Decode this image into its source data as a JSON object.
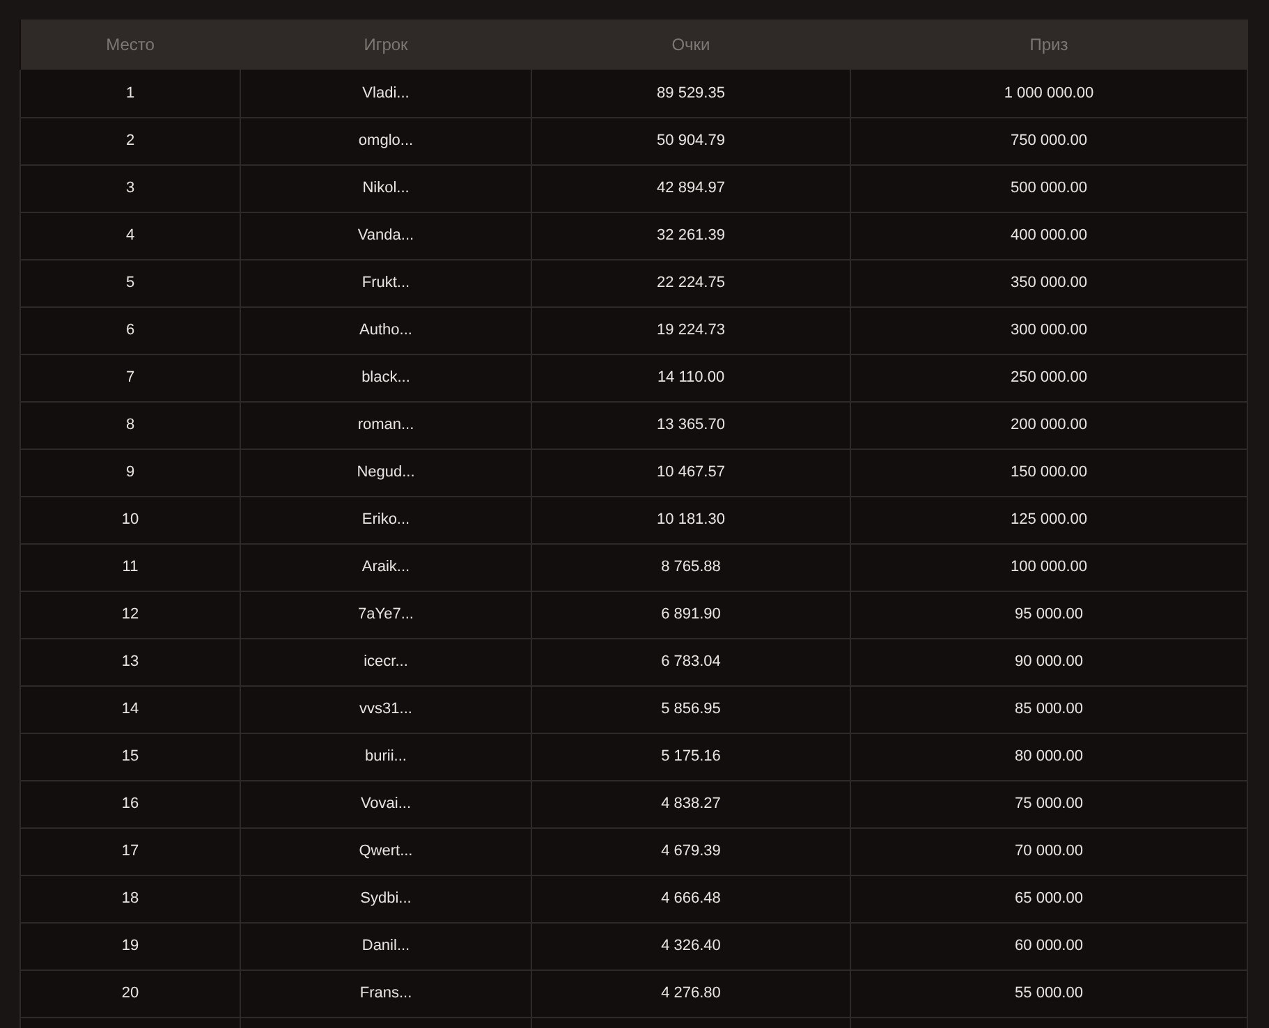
{
  "table": {
    "columns": [
      "Место",
      "Игрок",
      "Очки",
      "Приз"
    ],
    "rows": [
      [
        "1",
        "Vladi...",
        "89 529.35",
        "1 000 000.00"
      ],
      [
        "2",
        "omglo...",
        "50 904.79",
        "750 000.00"
      ],
      [
        "3",
        "Nikol...",
        "42 894.97",
        "500 000.00"
      ],
      [
        "4",
        "Vanda...",
        "32 261.39",
        "400 000.00"
      ],
      [
        "5",
        "Frukt...",
        "22 224.75",
        "350 000.00"
      ],
      [
        "6",
        "Autho...",
        "19 224.73",
        "300 000.00"
      ],
      [
        "7",
        "black...",
        "14 110.00",
        "250 000.00"
      ],
      [
        "8",
        "roman...",
        "13 365.70",
        "200 000.00"
      ],
      [
        "9",
        "Negud...",
        "10 467.57",
        "150 000.00"
      ],
      [
        "10",
        "Eriko...",
        "10 181.30",
        "125 000.00"
      ],
      [
        "11",
        "Araik...",
        "8 765.88",
        "100 000.00"
      ],
      [
        "12",
        "7aYe7...",
        "6 891.90",
        "95 000.00"
      ],
      [
        "13",
        "icecr...",
        "6 783.04",
        "90 000.00"
      ],
      [
        "14",
        "vvs31...",
        "5 856.95",
        "85 000.00"
      ],
      [
        "15",
        "burii...",
        "5 175.16",
        "80 000.00"
      ],
      [
        "16",
        "Vovai...",
        "4 838.27",
        "75 000.00"
      ],
      [
        "17",
        "Qwert...",
        "4 679.39",
        "70 000.00"
      ],
      [
        "18",
        "Sydbi...",
        "4 666.48",
        "65 000.00"
      ],
      [
        "19",
        "Danil...",
        "4 326.40",
        "60 000.00"
      ],
      [
        "20",
        "Frans...",
        "4 276.80",
        "55 000.00"
      ]
    ]
  }
}
